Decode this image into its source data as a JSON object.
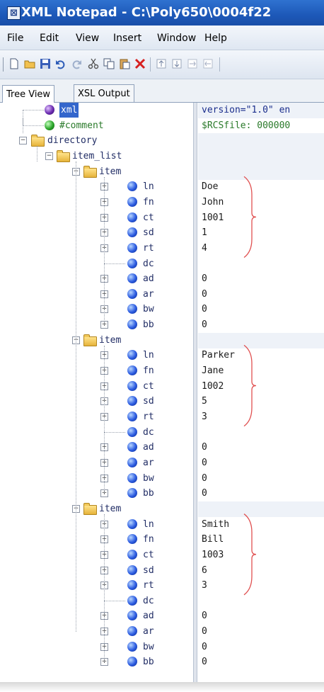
{
  "window": {
    "title": "XML Notepad - C:\\Poly650\\0004f22",
    "icon_glyph": "⊠"
  },
  "menu": [
    "File",
    "Edit",
    "View",
    "Insert",
    "Window",
    "Help"
  ],
  "toolbar_icons": [
    "new-icon",
    "open-icon",
    "save-icon",
    "undo-icon",
    "redo-icon",
    "cut-icon",
    "copy-icon",
    "paste-icon",
    "delete-icon",
    "nudge-up-icon",
    "nudge-down-icon",
    "indent-icon",
    "outdent-icon"
  ],
  "tabs": {
    "tree_view": "Tree View",
    "xsl_output": "XSL Output"
  },
  "tree": {
    "xml": {
      "label": "xml",
      "value": "version=\"1.0\" en"
    },
    "comment": {
      "label": "#comment",
      "value": "$RCSfile: 000000"
    },
    "directory": {
      "label": "directory"
    },
    "item_list": {
      "label": "item_list"
    },
    "items": [
      {
        "label": "item",
        "fields": [
          {
            "name": "ln",
            "value": "Doe"
          },
          {
            "name": "fn",
            "value": "John"
          },
          {
            "name": "ct",
            "value": "1001"
          },
          {
            "name": "sd",
            "value": "1"
          },
          {
            "name": "rt",
            "value": "4"
          },
          {
            "name": "dc",
            "value": ""
          },
          {
            "name": "ad",
            "value": "0"
          },
          {
            "name": "ar",
            "value": "0"
          },
          {
            "name": "bw",
            "value": "0"
          },
          {
            "name": "bb",
            "value": "0"
          }
        ]
      },
      {
        "label": "item",
        "fields": [
          {
            "name": "ln",
            "value": "Parker"
          },
          {
            "name": "fn",
            "value": "Jane"
          },
          {
            "name": "ct",
            "value": "1002"
          },
          {
            "name": "sd",
            "value": "5"
          },
          {
            "name": "rt",
            "value": "3"
          },
          {
            "name": "dc",
            "value": ""
          },
          {
            "name": "ad",
            "value": "0"
          },
          {
            "name": "ar",
            "value": "0"
          },
          {
            "name": "bw",
            "value": "0"
          },
          {
            "name": "bb",
            "value": "0"
          }
        ]
      },
      {
        "label": "item",
        "fields": [
          {
            "name": "ln",
            "value": "Smith"
          },
          {
            "name": "fn",
            "value": "Bill"
          },
          {
            "name": "ct",
            "value": "1003"
          },
          {
            "name": "sd",
            "value": "6"
          },
          {
            "name": "rt",
            "value": "3"
          },
          {
            "name": "dc",
            "value": ""
          },
          {
            "name": "ad",
            "value": "0"
          },
          {
            "name": "ar",
            "value": "0"
          },
          {
            "name": "bw",
            "value": "0"
          },
          {
            "name": "bb",
            "value": "0"
          }
        ]
      }
    ]
  },
  "colors": {
    "title_bar": "#1d58b8",
    "selection": "#3366cc",
    "node_text": "#222e66",
    "comment_text": "#2a7a2a",
    "annotation_bracket": "#e05050"
  }
}
